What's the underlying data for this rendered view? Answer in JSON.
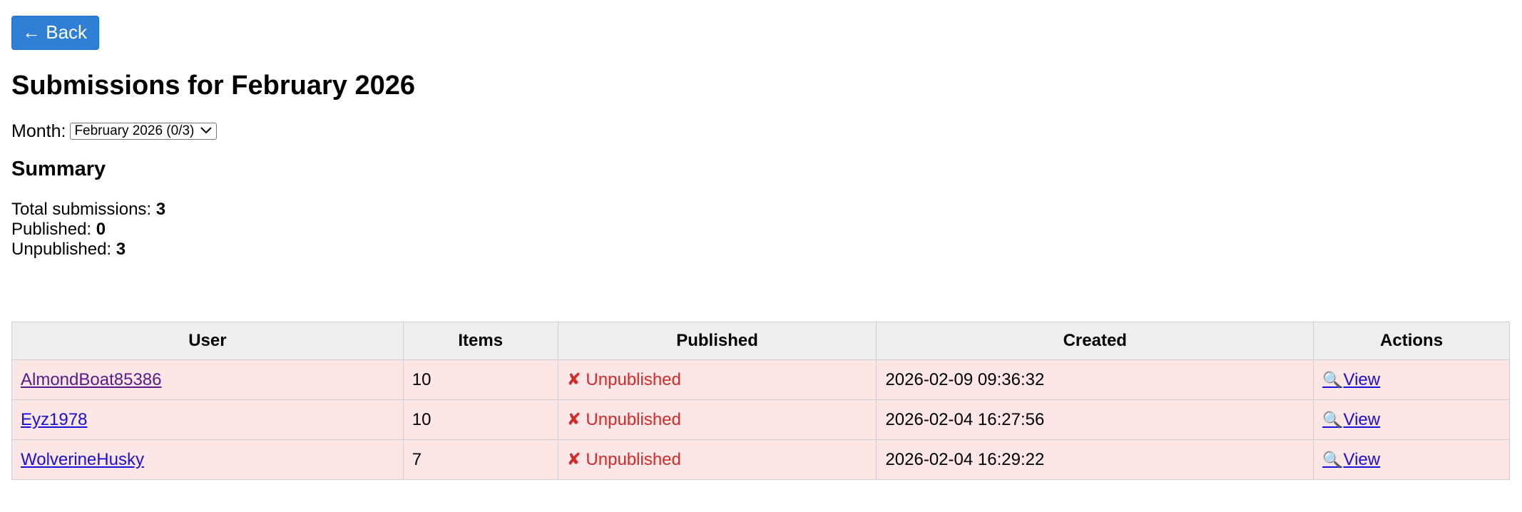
{
  "back_button": {
    "label": "← Back"
  },
  "page_title": "Submissions for February 2026",
  "month_filter": {
    "label": "Month:",
    "selected": "February 2026 (0/3)"
  },
  "summary": {
    "heading": "Summary",
    "total_label": "Total submissions:",
    "total_value": "3",
    "published_label": "Published:",
    "published_value": "0",
    "unpublished_label": "Unpublished:",
    "unpublished_value": "3"
  },
  "table": {
    "headers": [
      "User",
      "Items",
      "Published",
      "Created",
      "Actions"
    ],
    "rows": [
      {
        "user": "AlmondBoat85386",
        "items": "10",
        "status": "✘ Unpublished",
        "created": "2026-02-09 09:36:32",
        "action": "View"
      },
      {
        "user": "Eyz1978",
        "items": "10",
        "status": "✘ Unpublished",
        "created": "2026-02-04 16:27:56",
        "action": "View"
      },
      {
        "user": "WolverineHusky",
        "items": "7",
        "status": "✘ Unpublished",
        "created": "2026-02-04 16:29:22",
        "action": "View"
      }
    ]
  },
  "icons": {
    "view": "magnifying-glass-icon"
  },
  "colors": {
    "accent": "#2f7fd6",
    "row_bg": "#fde6e6",
    "status_red": "#d42a2a",
    "link": "#1a10d9",
    "visited_link": "#551a8b"
  }
}
